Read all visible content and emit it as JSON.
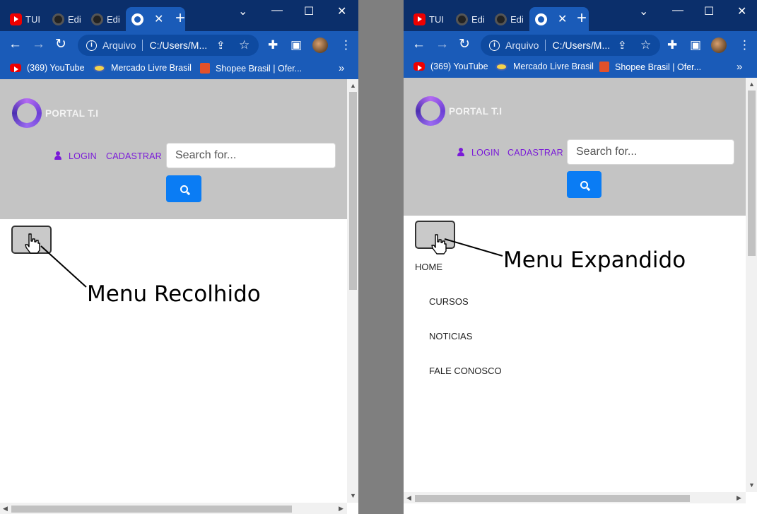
{
  "browser": {
    "tabs": [
      {
        "label": "TUI",
        "icon": "youtube-icon"
      },
      {
        "label": "Edi",
        "icon": "github-icon"
      },
      {
        "label": "Edi",
        "icon": "github-icon"
      },
      {
        "label": "",
        "icon": "globe-icon",
        "active": true
      }
    ],
    "close_tab": "✕",
    "new_tab": "+",
    "window_controls": {
      "tabsearch": "⌄",
      "minimize": "—",
      "maximize": "☐",
      "close": "✕"
    },
    "nav": {
      "back": "←",
      "forward": "→",
      "reload": "↻"
    },
    "address": {
      "scheme": "Arquivo",
      "url": "C:/Users/M..."
    },
    "toolbar_icons": {
      "share": "⇪",
      "star": "☆",
      "extensions": "✚",
      "sidepanel": "▣",
      "menu": "⋮"
    },
    "bookmarks": [
      "(369) YouTube",
      "Mercado Livre Brasil",
      "Shopee Brasil | Ofer..."
    ],
    "bookmarks_more": "»"
  },
  "site": {
    "logo_text": "PORTAL T.I",
    "login": "LOGIN",
    "register": "CADASTRAR",
    "search_placeholder": "Search for..."
  },
  "left_panel": {
    "annotation": "Menu Recolhido"
  },
  "right_panel": {
    "annotation": "Menu Expandido",
    "menu_items": [
      "HOME",
      "CURSOS",
      "NOTICIAS",
      "FALE CONOSCO"
    ]
  },
  "colors": {
    "tabstrip": "#0b2f6b",
    "toolbar": "#1a5bb8",
    "header_band": "#c4c4c4",
    "link": "#7a1ad8",
    "search_button": "#0a7cf4",
    "separator": "#7f7f7f"
  }
}
